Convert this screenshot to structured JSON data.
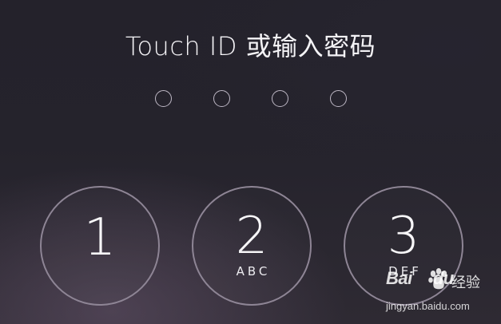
{
  "lock_screen": {
    "title": "Touch ID 或输入密码",
    "passcode_length": 4,
    "entered_digits": 0,
    "keys": [
      {
        "digit": "1",
        "letters": ""
      },
      {
        "digit": "2",
        "letters": "ABC"
      },
      {
        "digit": "3",
        "letters": "DEF"
      }
    ]
  },
  "watermark": {
    "logo": "Bai",
    "logo_suffix": "du",
    "label": "经验",
    "url": "jingyan.baidu.com",
    "paw_icon": "baidu-paw-icon"
  },
  "colors": {
    "ring": "#8e8595",
    "dot": "#bdb7c4",
    "text": "#ffffff"
  }
}
